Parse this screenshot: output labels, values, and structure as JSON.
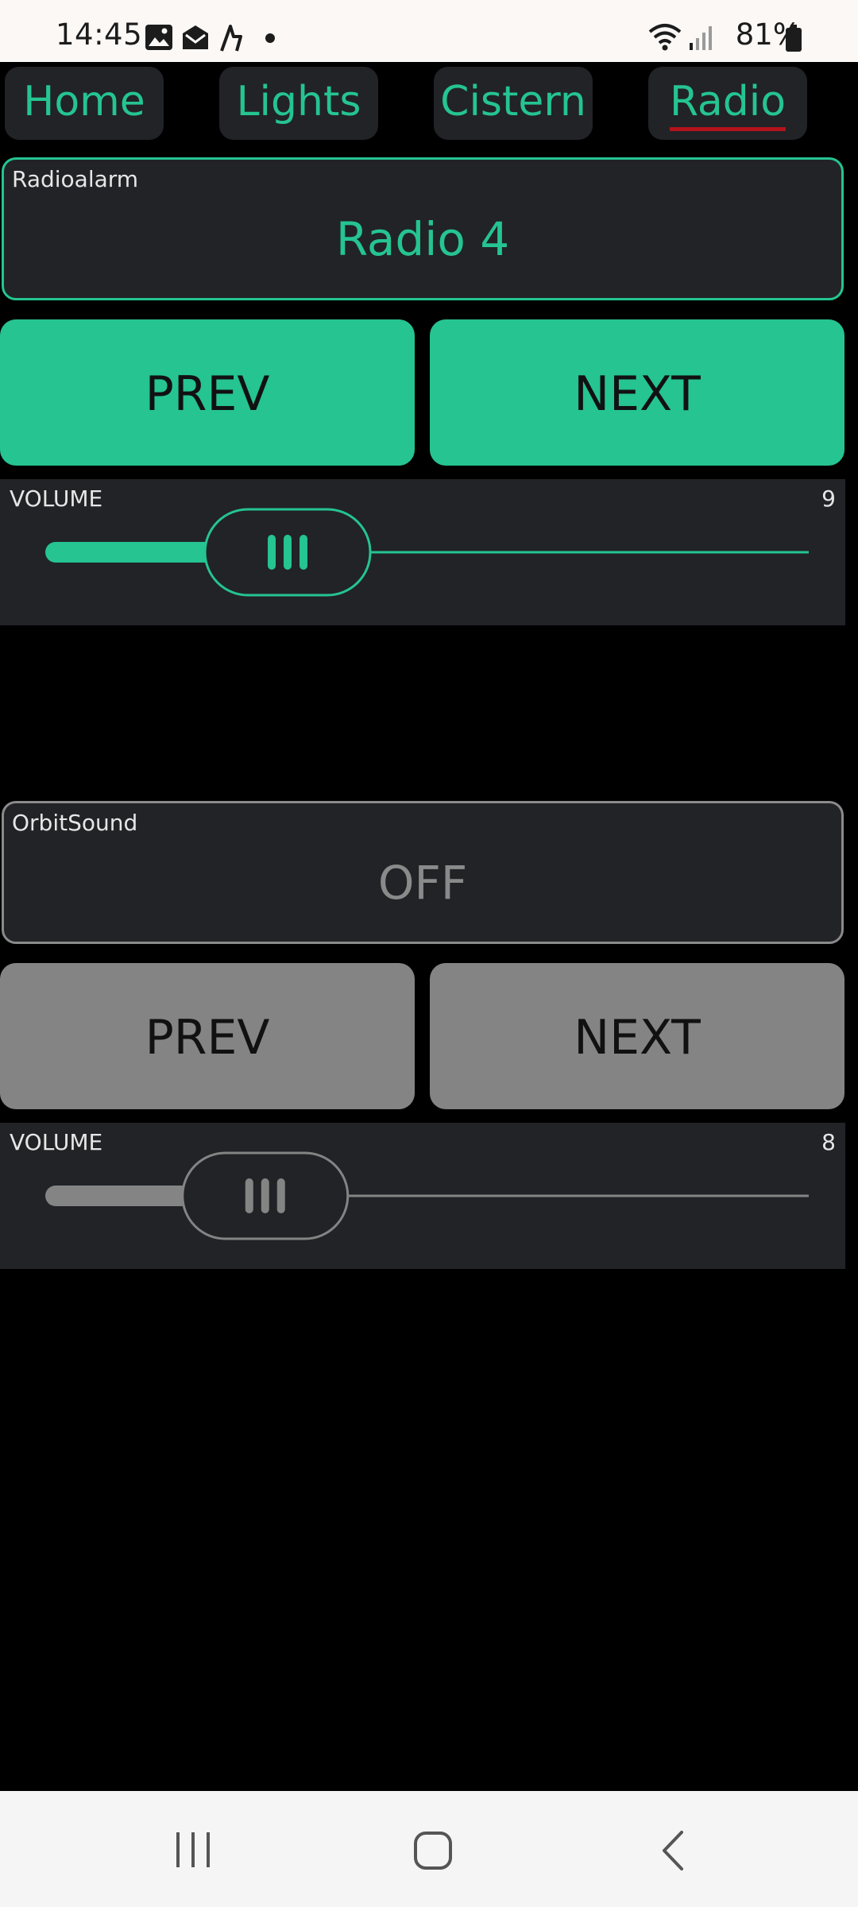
{
  "status_bar": {
    "time": "14:45",
    "battery_percent": "81%",
    "icons": [
      "image-icon",
      "mail-icon",
      "activity-icon",
      "dot-icon",
      "wifi-icon",
      "signal-icon",
      "battery-icon"
    ]
  },
  "tabs": [
    {
      "label": "Home",
      "active": false
    },
    {
      "label": "Lights",
      "active": false
    },
    {
      "label": "Cistern",
      "active": false
    },
    {
      "label": "Radio",
      "active": true
    }
  ],
  "radioalarm": {
    "caption": "Radioalarm",
    "value": "Radio 4",
    "prev_label": "PREV",
    "next_label": "NEXT",
    "volume_caption": "VOLUME",
    "volume_value": "9",
    "volume_fraction": 0.31,
    "accent": "#25c490"
  },
  "orbitsound": {
    "caption": "OrbitSound",
    "value": "OFF",
    "prev_label": "PREV",
    "next_label": "NEXT",
    "volume_caption": "VOLUME",
    "volume_value": "8",
    "volume_fraction": 0.28,
    "accent": "#848484"
  },
  "nav": {
    "icons": [
      "recent-apps-icon",
      "home-icon",
      "back-icon"
    ]
  }
}
